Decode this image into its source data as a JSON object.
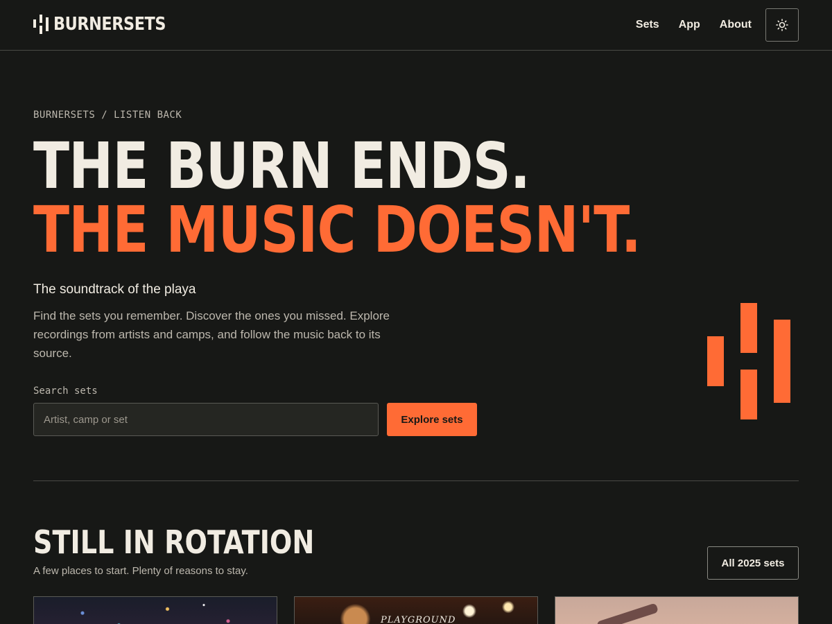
{
  "header": {
    "logo_text": "BURNERSETS",
    "nav": [
      "Sets",
      "App",
      "About"
    ],
    "theme_toggle_icon": "sun-icon"
  },
  "hero": {
    "eyebrow": "BURNERSETS / LISTEN BACK",
    "headline_line1": "THE BURN ENDS.",
    "headline_line2": "THE MUSIC DOESN'T.",
    "subtitle": "The soundtrack of the playa",
    "description": "Find the sets you remember. Discover the ones you missed. Explore recordings from artists and camps, and follow the music back to its source.",
    "search": {
      "label": "Search sets",
      "placeholder": "Artist, camp or set",
      "value": ""
    },
    "explore_label": "Explore sets"
  },
  "rotation": {
    "title": "STILL IN ROTATION",
    "subtitle": "A few places to start. Plenty of reasons to stay.",
    "all_sets_label": "All 2025 sets",
    "cards": [
      {
        "image": "bokeh-lights-photo"
      },
      {
        "image": "playground-camp-photo",
        "text": "PLAYGROUND"
      },
      {
        "image": "sunset-silhouette-photo"
      }
    ]
  },
  "colors": {
    "background": "#171816",
    "text": "#f1ece2",
    "accent": "#ff6b35",
    "muted": "#bdb8ae"
  }
}
